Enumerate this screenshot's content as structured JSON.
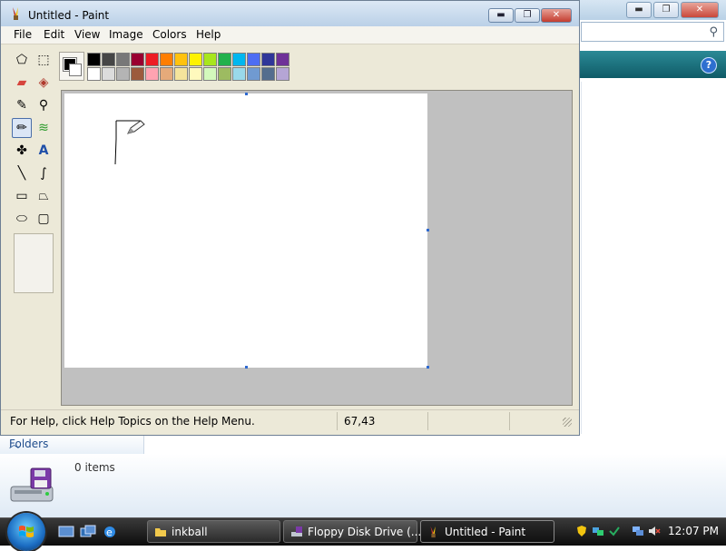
{
  "paint": {
    "title": "Untitled - Paint",
    "window_buttons": {
      "minimize": "▬",
      "maximize": "❐",
      "close": "✕"
    },
    "menu": [
      "File",
      "Edit",
      "View",
      "Image",
      "Colors",
      "Help"
    ],
    "tools": [
      {
        "name": "free-form-select-icon",
        "glyph": "⬠"
      },
      {
        "name": "select-icon",
        "glyph": "⬚"
      },
      {
        "name": "eraser-icon",
        "glyph": "▰"
      },
      {
        "name": "fill-icon",
        "glyph": "◈"
      },
      {
        "name": "pick-color-icon",
        "glyph": "✎"
      },
      {
        "name": "magnifier-icon",
        "glyph": "⚲"
      },
      {
        "name": "pencil-icon",
        "glyph": "✏"
      },
      {
        "name": "brush-icon",
        "glyph": "≋"
      },
      {
        "name": "airbrush-icon",
        "glyph": "✤"
      },
      {
        "name": "text-icon",
        "glyph": "A"
      },
      {
        "name": "line-icon",
        "glyph": "╲"
      },
      {
        "name": "curve-icon",
        "glyph": "∫"
      },
      {
        "name": "rectangle-icon",
        "glyph": "▭"
      },
      {
        "name": "polygon-icon",
        "glyph": "⏢"
      },
      {
        "name": "ellipse-icon",
        "glyph": "⬭"
      },
      {
        "name": "rounded-rectangle-icon",
        "glyph": "▢"
      }
    ],
    "active_tool": "pencil-icon",
    "foreground_color": "#000000",
    "background_color": "#ffffff",
    "palette_colors": [
      "#000000",
      "#464646",
      "#787878",
      "#990030",
      "#ed1c24",
      "#ff7e00",
      "#ffc20e",
      "#fff200",
      "#a8e61d",
      "#22b14c",
      "#00b7ef",
      "#4d6df3",
      "#2f3699",
      "#6f3198",
      "#ffffff",
      "#dcdcdc",
      "#b4b4b4",
      "#9c5a3c",
      "#ffa3b1",
      "#e5aa7a",
      "#f5e49c",
      "#fff9bd",
      "#d3f9bc",
      "#9dbb61",
      "#99d9ea",
      "#709ad1",
      "#546d8e",
      "#b5a5d5"
    ],
    "status": {
      "help_text": "For Help, click Help Topics on the Help Menu.",
      "coordinates": "67,43"
    }
  },
  "explorer": {
    "folders_label": "Folders",
    "items_count": "0 items"
  },
  "taskbar": {
    "items": [
      {
        "label": "inkball",
        "icon": "folder-icon"
      },
      {
        "label": "Floppy Disk Drive (...",
        "icon": "floppy-drive-icon"
      },
      {
        "label": "Untitled - Paint",
        "icon": "paint-icon",
        "active": true
      }
    ],
    "clock": "12:07 PM"
  }
}
